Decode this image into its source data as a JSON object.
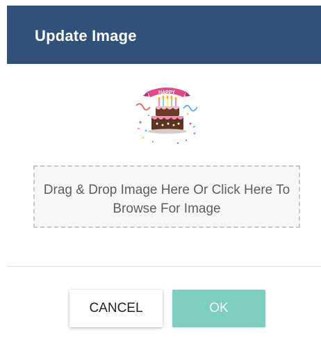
{
  "dialog": {
    "title": "Update Image",
    "preview": {
      "banner_text": "HAPPY",
      "icon": "birthday-cake-image"
    },
    "dropzone": {
      "text": "Drag & Drop Image Here Or Click Here To Browse For Image"
    },
    "buttons": {
      "cancel_label": "CANCEL",
      "ok_label": "OK"
    }
  },
  "colors": {
    "header": "#305179",
    "ok_button": "#7ecdc1",
    "dropzone_border": "#c8c8c8"
  }
}
